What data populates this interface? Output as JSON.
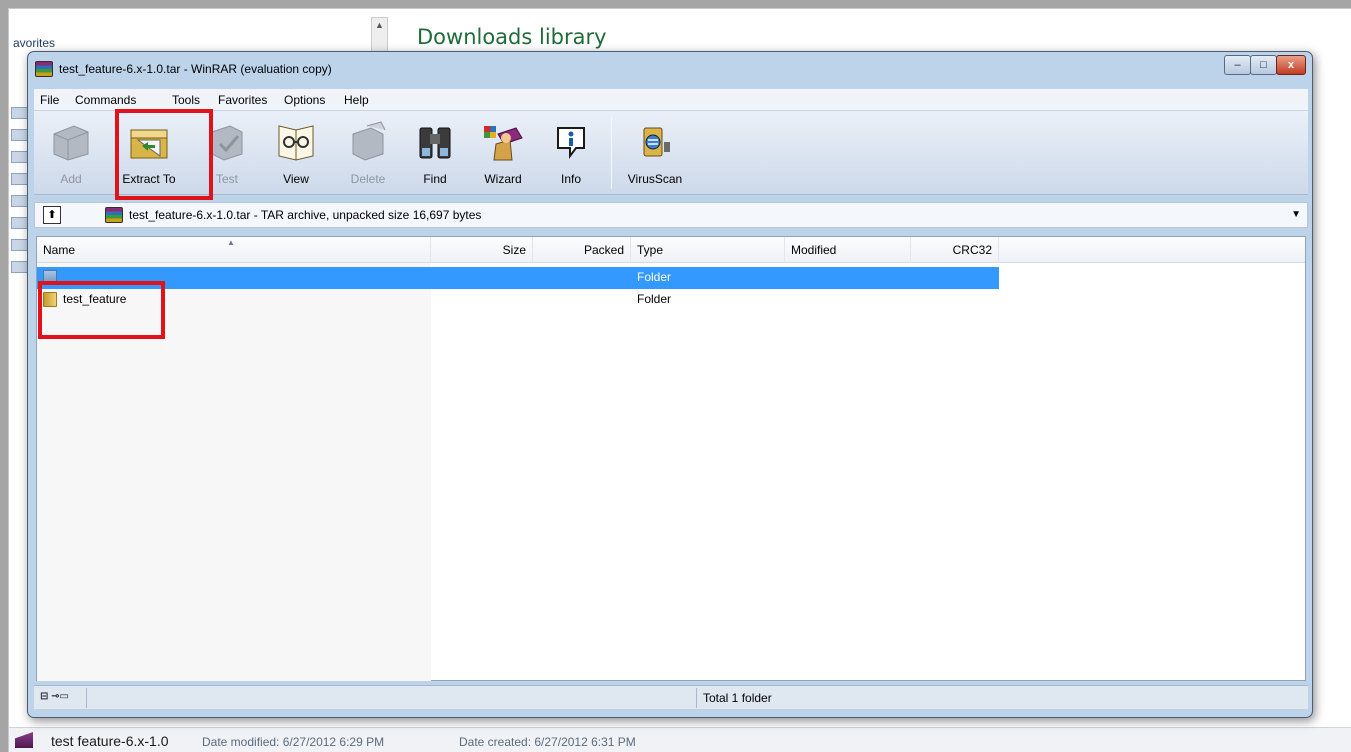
{
  "explorer": {
    "favorites_label": "avorites",
    "library_title": "Downloads library",
    "scroll_up_glyph": "▲",
    "bottom": {
      "name": "test feature-6.x-1.0",
      "date_modified": "Date modified: 6/27/2012 6:29 PM",
      "date_created": "Date created: 6/27/2012 6:31 PM"
    }
  },
  "window": {
    "title": "test_feature-6.x-1.0.tar - WinRAR (evaluation copy)",
    "controls": {
      "minimize": "–",
      "maximize": "□",
      "close": "x"
    }
  },
  "menu": [
    "File",
    "Commands",
    "Tools",
    "Favorites",
    "Options",
    "Help"
  ],
  "toolbar": [
    {
      "label": "Add",
      "icon": "add-icon",
      "enabled": false
    },
    {
      "label": "Extract To",
      "icon": "extract-icon",
      "enabled": true
    },
    {
      "label": "Test",
      "icon": "test-icon",
      "enabled": false
    },
    {
      "label": "View",
      "icon": "view-icon",
      "enabled": true
    },
    {
      "label": "Delete",
      "icon": "delete-icon",
      "enabled": false
    },
    {
      "label": "Find",
      "icon": "binoculars-icon",
      "enabled": true
    },
    {
      "label": "Wizard",
      "icon": "wizard-icon",
      "enabled": true
    },
    {
      "label": "Info",
      "icon": "info-icon",
      "enabled": true
    },
    {
      "label": "VirusScan",
      "icon": "virusscan-icon",
      "enabled": true
    }
  ],
  "address": {
    "up_glyph": "⬆",
    "text": "test_feature-6.x-1.0.tar - TAR archive, unpacked size 16,697 bytes",
    "dropdown_glyph": "▼"
  },
  "columns": [
    "Name",
    "Size",
    "Packed",
    "Type",
    "Modified",
    "CRC32"
  ],
  "rows": [
    {
      "name": "",
      "size": "",
      "packed": "",
      "type": "Folder",
      "modified": "",
      "crc": "",
      "selected": true,
      "kind": "parent"
    },
    {
      "name": "test_feature",
      "size": "",
      "packed": "",
      "type": "Folder",
      "modified": "",
      "crc": "",
      "selected": false,
      "kind": "folder"
    }
  ],
  "status": {
    "icon_text": "⊟ ⊸▭",
    "text": "Total 1 folder"
  },
  "colors": {
    "highlight": "#e0121a",
    "selection": "#3399ff"
  }
}
